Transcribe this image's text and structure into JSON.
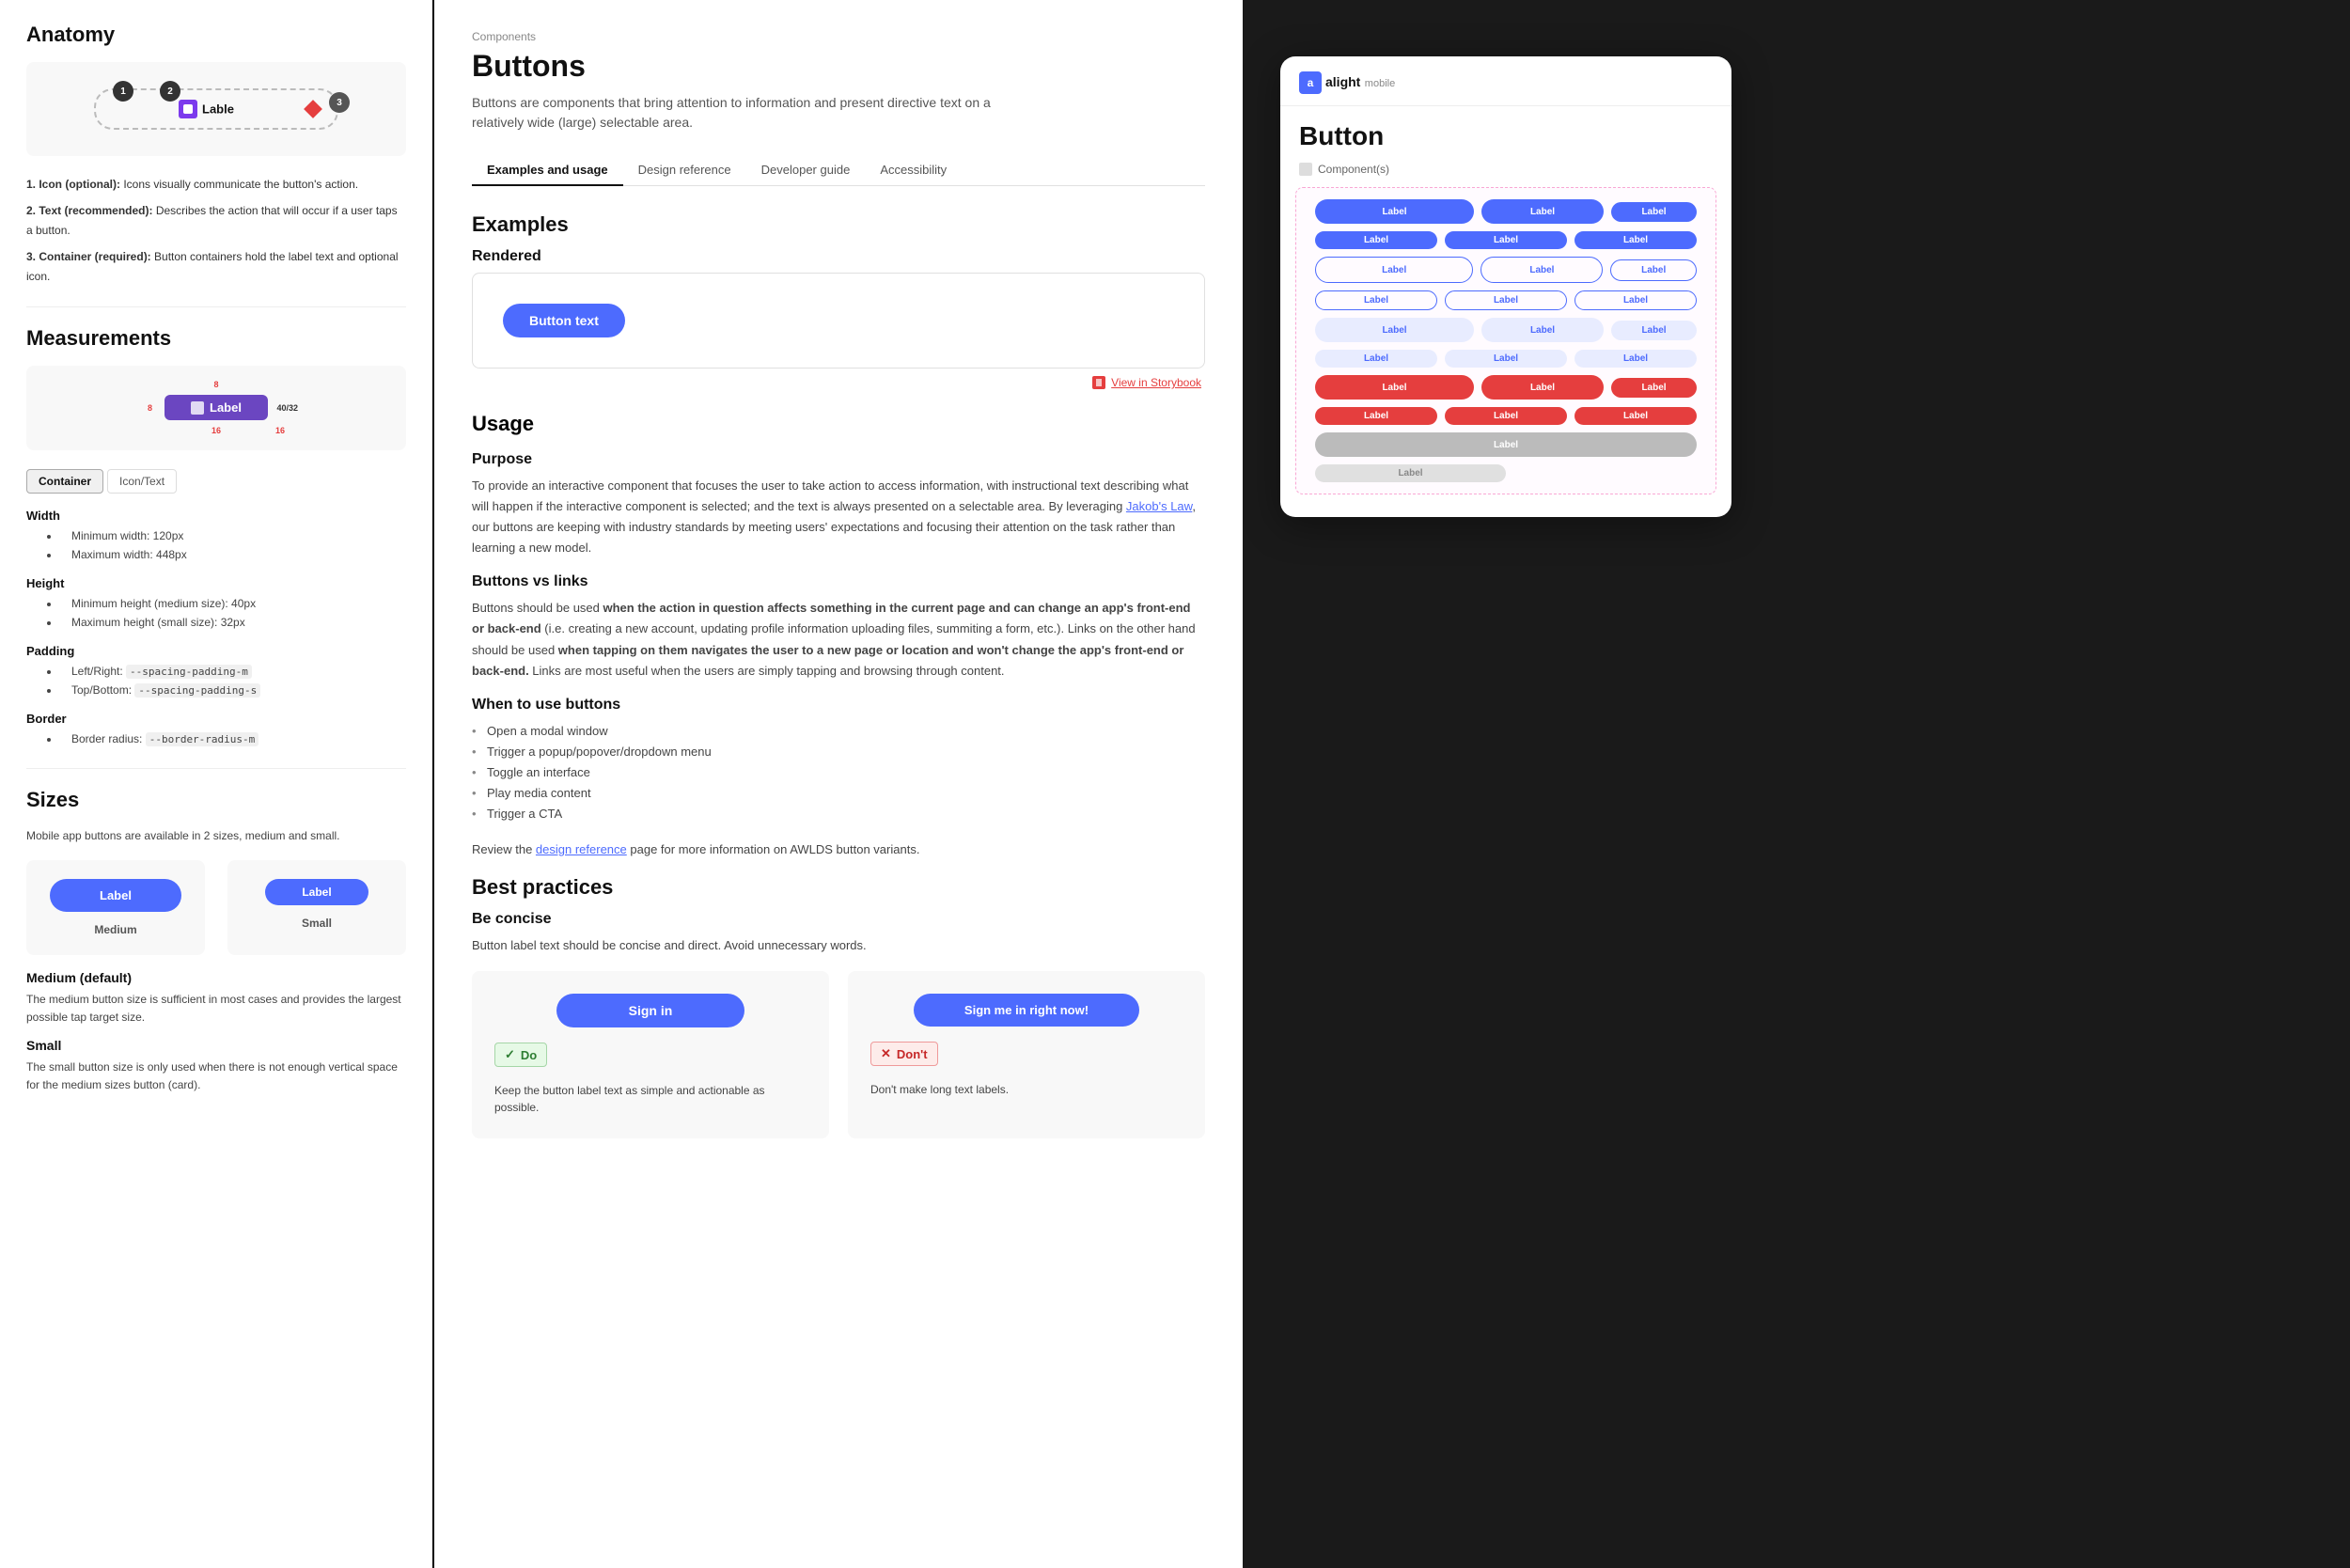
{
  "left": {
    "anatomy_title": "Anatomy",
    "anatomy_items": [
      {
        "num": "1",
        "label": "Icon (optional):",
        "desc": "Icons visually communicate the button's action."
      },
      {
        "num": "2",
        "label": "Text (recommended):",
        "desc": "Describes the action that will occur if a user taps a button."
      },
      {
        "num": "3",
        "label": "Container (required):",
        "desc": "Button containers hold the label text and optional icon."
      }
    ],
    "measurements_title": "Measurements",
    "measurement_label": "Label",
    "meas_40_32": "40/32",
    "tabs": [
      "Container",
      "Icon/Text"
    ],
    "active_tab": "Container",
    "props": {
      "width_label": "Width",
      "width_min": "Minimum width: 120px",
      "width_max": "Maximum width: 448px",
      "height_label": "Height",
      "height_min": "Minimum height (medium size): 40px",
      "height_max": "Maximum height (small size): 32px",
      "padding_label": "Padding",
      "padding_lr": "Left/Right:  --spacing-padding-m",
      "padding_tb": "Top/Bottom:  --spacing-padding-s",
      "border_label": "Border",
      "border_radius": "Border radius:  --border-radius-m"
    },
    "sizes_title": "Sizes",
    "sizes_desc": "Mobile app buttons are available in 2 sizes, medium and small.",
    "btn_label": "Label",
    "medium_label": "Medium",
    "small_label": "Small",
    "medium_default_title": "Medium (default)",
    "medium_default_desc": "The medium button size is sufficient in most cases and provides the largest possible tap target size.",
    "small_title": "Small",
    "small_desc": "The small button size is only used when there is not enough vertical space for the medium sizes button (card)."
  },
  "middle": {
    "breadcrumb": "Components",
    "page_title": "Buttons",
    "page_description": "Buttons are components that bring attention to information and present directive text on a relatively wide (large) selectable area.",
    "nav_tabs": [
      "Examples and usage",
      "Design reference",
      "Developer guide",
      "Accessibility"
    ],
    "active_nav": "Examples and usage",
    "examples_title": "Examples",
    "rendered_label": "Rendered",
    "rendered_btn_text": "Button text",
    "storybook_link": "View in Storybook",
    "usage_title": "Usage",
    "purpose_title": "Purpose",
    "purpose_text": "To provide an interactive component that focuses the user to take action to access information, with instructional text describing what will happen if the interactive component is selected; and the text is always presented on a selectable area. By leveraging Jakob's Law, our buttons are keeping with industry standards by meeting users' expectations and focusing their attention on the task rather than learning a new model.",
    "buttons_vs_links_title": "Buttons vs links",
    "bvl_text_1": "Buttons should be used when the action in question affects something in the current page and can change an app's front-end or back-end (i.e. creating a new account, updating profile information uploading files, summiting a form, etc.). Links on the other hand should be used when tapping on them navigates the user to a new page or location and won't change the app's front-end or back-end. Links are most useful when the users are simply tapping and browsing through content.",
    "when_to_use_title": "When to use buttons",
    "when_items": [
      "Open a modal window",
      "Trigger a popup/popover/dropdown menu",
      "Toggle an interface",
      "Play media content",
      "Trigger a CTA"
    ],
    "review_text_pre": "Review the ",
    "review_link": "design reference",
    "review_text_post": " page for more information on AWLDS button variants.",
    "best_practices_title": "Best practices",
    "be_concise_title": "Be concise",
    "be_concise_desc": "Button label text should be concise and direct. Avoid unnecessary words.",
    "bp_good_btn": "Sign in",
    "bp_bad_btn": "Sign me in right now!",
    "bp_do_label": "Do",
    "bp_dont_label": "Don't",
    "bp_good_text": "Keep the button label text as simple and actionable as possible.",
    "bp_bad_text": "Don't make long text labels."
  },
  "right": {
    "logo_icon": "a",
    "logo_main": "alight",
    "logo_sub": "mobile",
    "card_title": "Button",
    "component_label": "Component(s)",
    "btn_label": "Label"
  }
}
